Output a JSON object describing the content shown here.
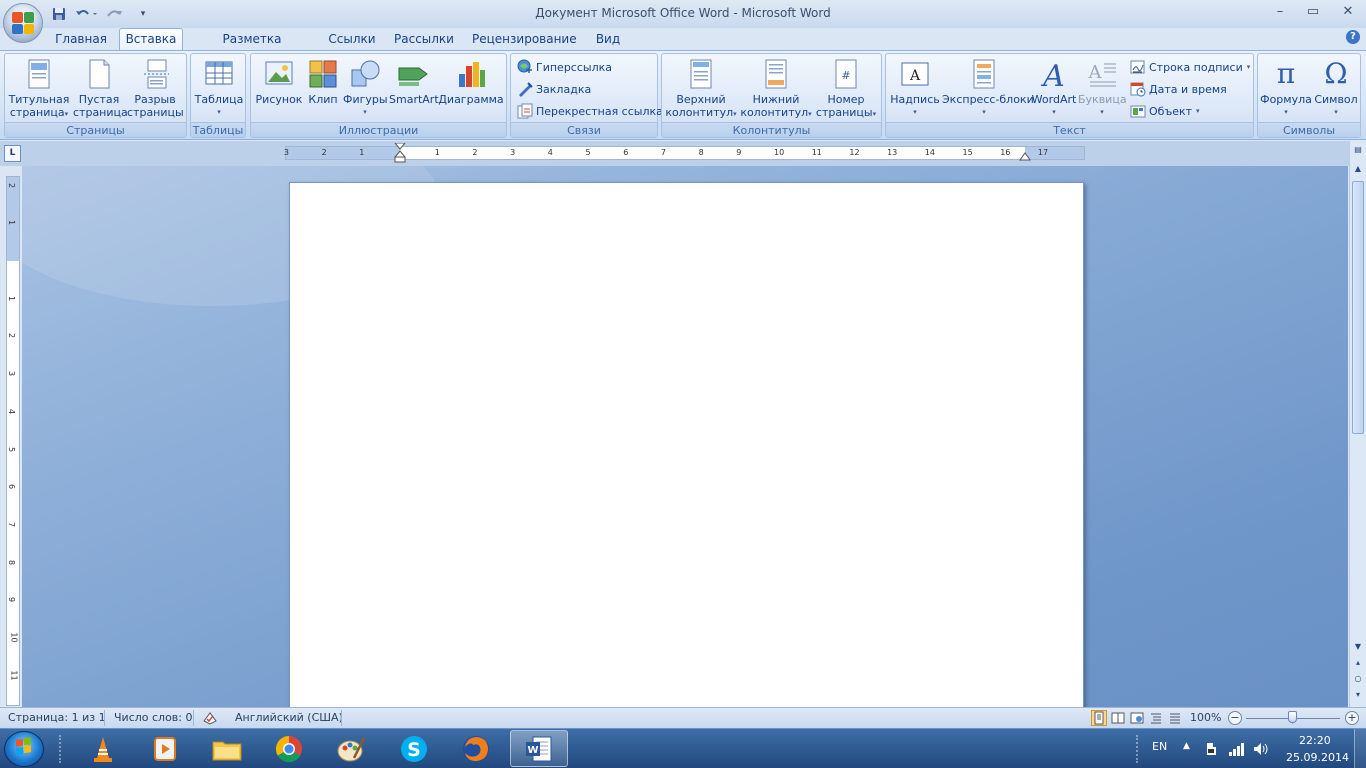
{
  "window": {
    "title": "Документ Microsoft Office Word - Microsoft Word",
    "minimize": "–",
    "maximize": "▭",
    "close": "✕"
  },
  "tabs": [
    {
      "label": "Главная",
      "active": false
    },
    {
      "label": "Вставка",
      "active": true
    },
    {
      "label": "Разметка страницы",
      "active": false
    },
    {
      "label": "Ссылки",
      "active": false
    },
    {
      "label": "Рассылки",
      "active": false
    },
    {
      "label": "Рецензирование",
      "active": false
    },
    {
      "label": "Вид",
      "active": false
    }
  ],
  "help": "?",
  "ribbon": {
    "groups": [
      {
        "label": "Страницы",
        "buttons": [
          {
            "line1": "Титульная",
            "line2": "страница",
            "icon": "cover-page-icon",
            "dropdown": true
          },
          {
            "line1": "Пустая",
            "line2": "страница",
            "icon": "blank-page-icon",
            "dropdown": false
          },
          {
            "line1": "Разрыв",
            "line2": "страницы",
            "icon": "page-break-icon",
            "dropdown": false
          }
        ]
      },
      {
        "label": "Таблицы",
        "buttons": [
          {
            "line1": "Таблица",
            "line2": "",
            "icon": "table-icon",
            "dropdown": true
          }
        ]
      },
      {
        "label": "Иллюстрации",
        "buttons": [
          {
            "line1": "Рисунок",
            "line2": "",
            "icon": "picture-icon",
            "dropdown": false
          },
          {
            "line1": "Клип",
            "line2": "",
            "icon": "clipart-icon",
            "dropdown": false
          },
          {
            "line1": "Фигуры",
            "line2": "",
            "icon": "shapes-icon",
            "dropdown": true
          },
          {
            "line1": "SmartArt",
            "line2": "",
            "icon": "smartart-icon",
            "dropdown": false
          },
          {
            "line1": "Диаграмма",
            "line2": "",
            "icon": "chart-icon",
            "dropdown": false
          }
        ]
      },
      {
        "label": "Связи",
        "buttons": [
          {
            "line1": "Гиперссылка",
            "icon": "hyperlink-icon"
          },
          {
            "line1": "Закладка",
            "icon": "bookmark-icon"
          },
          {
            "line1": "Перекрестная ссылка",
            "icon": "cross-reference-icon"
          }
        ]
      },
      {
        "label": "Колонтитулы",
        "buttons": [
          {
            "line1": "Верхний",
            "line2": "колонтитул",
            "icon": "header-icon",
            "dropdown": true
          },
          {
            "line1": "Нижний",
            "line2": "колонтитул",
            "icon": "footer-icon",
            "dropdown": true
          },
          {
            "line1": "Номер",
            "line2": "страницы",
            "icon": "page-number-icon",
            "dropdown": true
          }
        ]
      },
      {
        "label": "Текст",
        "buttons": [
          {
            "line1": "Надпись",
            "line2": "",
            "icon": "textbox-icon",
            "dropdown": true
          },
          {
            "line1": "Экспресс-блоки",
            "line2": "",
            "icon": "quick-parts-icon",
            "dropdown": true
          },
          {
            "line1": "WordArt",
            "line2": "",
            "icon": "wordart-icon",
            "dropdown": true
          },
          {
            "line1": "Буквица",
            "line2": "",
            "icon": "dropcap-icon",
            "dropdown": true,
            "disabled": true
          }
        ],
        "small": [
          {
            "label": "Строка подписи",
            "icon": "signature-line-icon",
            "dropdown": true
          },
          {
            "label": "Дата и время",
            "icon": "date-time-icon",
            "dropdown": false
          },
          {
            "label": "Объект",
            "icon": "object-icon",
            "dropdown": true
          }
        ]
      },
      {
        "label": "Символы",
        "buttons": [
          {
            "line1": "Формула",
            "line2": "",
            "icon": "equation-icon",
            "glyph": "π",
            "dropdown": true
          },
          {
            "line1": "Символ",
            "line2": "",
            "icon": "symbol-icon",
            "glyph": "Ω",
            "dropdown": true
          }
        ]
      }
    ]
  },
  "ruler": {
    "tab_selector": "L",
    "h_numbers": [
      "3",
      "2",
      "1",
      "1",
      "2",
      "3",
      "4",
      "5",
      "6",
      "7",
      "8",
      "9",
      "10",
      "11",
      "12",
      "13",
      "14",
      "15",
      "16",
      "17"
    ],
    "v_numbers": [
      "2",
      "1",
      "1",
      "2",
      "3",
      "4",
      "5",
      "6",
      "7",
      "8",
      "9",
      "10",
      "11"
    ]
  },
  "statusbar": {
    "page": "Страница: 1 из 1",
    "words": "Число слов: 0",
    "language": "Английский (США)",
    "zoom": "100%",
    "zoom_minus": "−",
    "zoom_plus": "+"
  },
  "taskbar": {
    "apps": [
      "vlc-icon",
      "media-player-icon",
      "file-explorer-icon",
      "chrome-icon",
      "paint-icon",
      "skype-icon",
      "firefox-icon",
      "word-icon"
    ],
    "active_app": "word-icon",
    "lang": "EN",
    "time": "22:20",
    "date": "25.09.2014"
  },
  "colors": {
    "accent": "#15428b",
    "ribbon": "#dbe7f7",
    "doc_background": "#6f96c9"
  }
}
